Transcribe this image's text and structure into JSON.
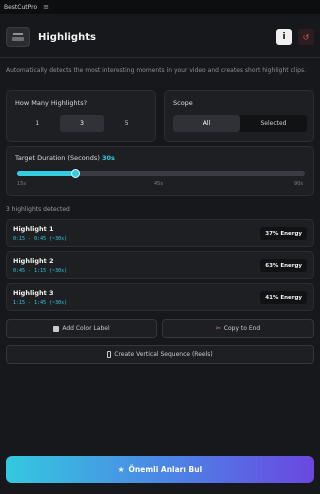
{
  "app": {
    "name": "BestCutPro",
    "menu_icon": "hamburger-icon"
  },
  "header": {
    "title": "Highlights",
    "info_label": "i",
    "reset_glyph": "↺"
  },
  "description": "Automatically detects the most interesting moments in your video and creates short highlight clips.",
  "count_setting": {
    "label": "How Many Highlights?",
    "options": [
      "1",
      "3",
      "5"
    ],
    "selected": "3"
  },
  "scope_setting": {
    "label": "Scope",
    "options": [
      "All",
      "Selected"
    ],
    "selected": "All"
  },
  "duration_setting": {
    "label": "Target Duration (Seconds)",
    "value_label": "30s",
    "value": 30,
    "min": 15,
    "max": 90,
    "ticks": [
      "15s",
      "45s",
      "90s"
    ]
  },
  "detected_text": "3 highlights detected",
  "highlights": [
    {
      "title": "Highlight 1",
      "time": "0:15 - 0:45 (~30s)",
      "energy": "37% Energy"
    },
    {
      "title": "Highlight 2",
      "time": "0:45 - 1:15 (~30s)",
      "energy": "63% Energy"
    },
    {
      "title": "Highlight 3",
      "time": "1:15 - 1:45 (~30s)",
      "energy": "41% Energy"
    }
  ],
  "actions": {
    "add_color_label": "Add Color Label",
    "copy_to_end": "Copy to End",
    "create_vertical": "Create Vertical Sequence (Reels)"
  },
  "primary_action": {
    "label": "Önemli Anları Bul",
    "icon": "★"
  },
  "colors": {
    "accent": "#34cde0",
    "danger": "#e05561",
    "gradient_end": "#6b47e0"
  }
}
